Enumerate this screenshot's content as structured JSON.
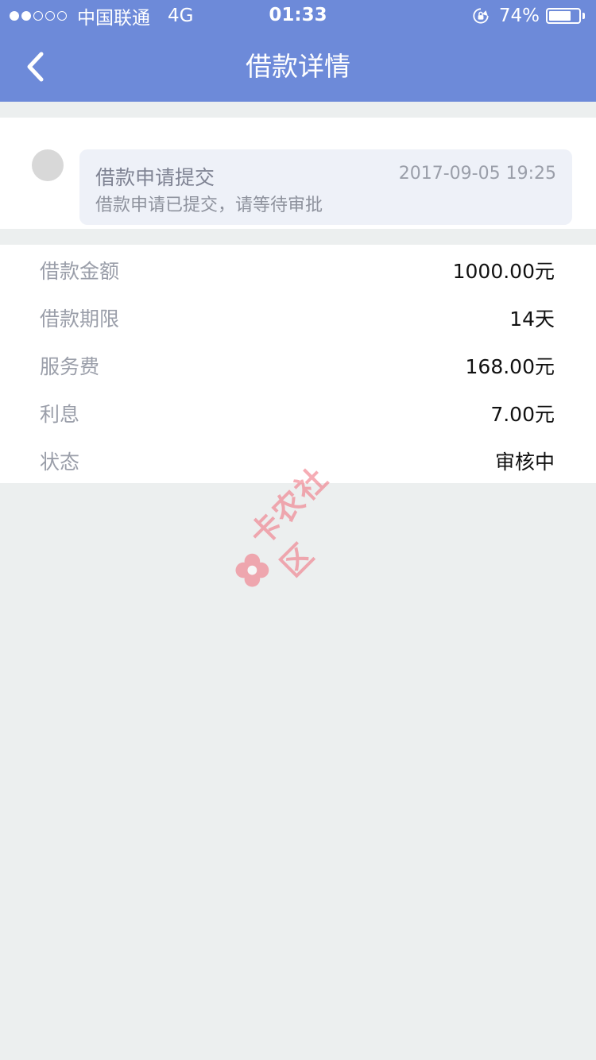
{
  "status_bar": {
    "carrier": "中国联通",
    "network": "4G",
    "time": "01:33",
    "battery_percent": "74%",
    "battery_level": 0.74
  },
  "nav": {
    "title": "借款详情",
    "back_icon": "chevron-left-icon"
  },
  "timeline": {
    "event_title": "借款申请提交",
    "event_time": "2017-09-05 19:25",
    "event_desc": "借款申请已提交，请等待审批"
  },
  "details": [
    {
      "label": "借款金额",
      "value": "1000.00元"
    },
    {
      "label": "借款期限",
      "value": "14天"
    },
    {
      "label": "服务费",
      "value": "168.00元"
    },
    {
      "label": "利息",
      "value": "7.00元"
    },
    {
      "label": "状态",
      "value": "审核中"
    }
  ],
  "watermark": {
    "text": "卡农社区"
  },
  "colors": {
    "header": "#6d8ad9",
    "background": "#ecefef",
    "bubble": "#eef1f8",
    "watermark": "#f06b7a"
  }
}
